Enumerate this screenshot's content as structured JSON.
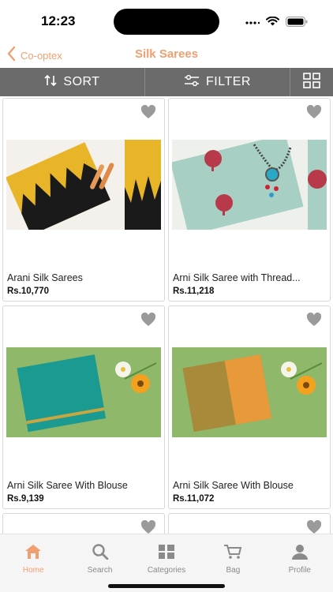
{
  "status": {
    "time": "12:23"
  },
  "header": {
    "back_label": "Co-optex",
    "title": "Silk Sarees"
  },
  "toolbar": {
    "sort_label": "SORT",
    "filter_label": "FILTER"
  },
  "products": [
    {
      "name": "Arani Silk Sarees",
      "price": "Rs.10,770"
    },
    {
      "name": "Arni Silk Saree with Thread...",
      "price": "Rs.11,218"
    },
    {
      "name": "Arni Silk Saree With Blouse",
      "price": "Rs.9,139"
    },
    {
      "name": "Arni Silk Saree With Blouse",
      "price": "Rs.11,072"
    }
  ],
  "tabbar": {
    "active": "Home",
    "items": [
      {
        "label": "Home",
        "icon": "home-icon"
      },
      {
        "label": "Search",
        "icon": "search-icon"
      },
      {
        "label": "Categories",
        "icon": "categories-icon"
      },
      {
        "label": "Bag",
        "icon": "bag-icon"
      },
      {
        "label": "Profile",
        "icon": "profile-icon"
      }
    ]
  },
  "colors": {
    "accent": "#f0a070",
    "toolbar": "#6b6b6b",
    "muted": "#8a8a8a"
  }
}
